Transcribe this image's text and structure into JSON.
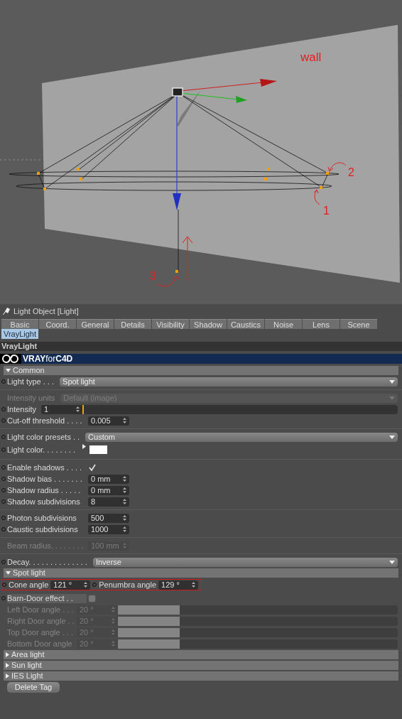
{
  "viewport": {
    "annotations": [
      {
        "text": "wall"
      },
      {
        "text": "2"
      },
      {
        "text": "1"
      },
      {
        "text": "3"
      }
    ]
  },
  "panel": {
    "title": "Light Object [Light]",
    "tabs": [
      {
        "label": "Basic",
        "selected": false
      },
      {
        "label": "Coord.",
        "selected": false
      },
      {
        "label": "General",
        "selected": false
      },
      {
        "label": "Details",
        "selected": false
      },
      {
        "label": "Visibility",
        "selected": false
      },
      {
        "label": "Shadow",
        "selected": false
      },
      {
        "label": "Caustics",
        "selected": false
      },
      {
        "label": "Noise",
        "selected": false
      },
      {
        "label": "Lens",
        "selected": false
      },
      {
        "label": "Scene",
        "selected": false
      },
      {
        "label": "VrayLight",
        "selected": true
      }
    ],
    "section_title": "VrayLight",
    "logo": "**VRAY**for**C4D**",
    "rows": [
      {
        "kind": "group",
        "label": "Common",
        "expanded": true
      },
      {
        "kind": "dropdown",
        "label": "Light type . . .",
        "value": "Spot light",
        "disabled": false
      },
      {
        "kind": "separator"
      },
      {
        "kind": "dropdown",
        "label": "Intensity units",
        "value": "Default (image)",
        "disabled": true
      },
      {
        "kind": "slider",
        "label": "Intensity",
        "value": "1",
        "level": 0,
        "disabled": false
      },
      {
        "kind": "number",
        "label": "Cut-off threshold . . . .",
        "value": "0.005",
        "disabled": false
      },
      {
        "kind": "separator"
      },
      {
        "kind": "dropdown",
        "label": "Light color presets . .",
        "value": "Custom",
        "disabled": false
      },
      {
        "kind": "color",
        "label": "Light color. . . . . . . .",
        "color": "#ffffff",
        "disabled": false
      },
      {
        "kind": "separator"
      },
      {
        "kind": "checkbox",
        "label": "Enable shadows . . . .",
        "checked": true,
        "disabled": false
      },
      {
        "kind": "number",
        "label": "Shadow bias . . . . . . .",
        "value": "0 mm",
        "disabled": false
      },
      {
        "kind": "number",
        "label": "Shadow radius . . . . .",
        "value": "0 mm",
        "disabled": false
      },
      {
        "kind": "number",
        "label": "Shadow subdivisions",
        "value": "8",
        "disabled": false
      },
      {
        "kind": "separator"
      },
      {
        "kind": "number",
        "label": "Photon subdivisions",
        "value": "500",
        "disabled": false
      },
      {
        "kind": "number",
        "label": "Caustic subdivisions",
        "value": "1000",
        "disabled": false
      },
      {
        "kind": "separator"
      },
      {
        "kind": "number",
        "label": "Beam radius. . . . . . . .",
        "value": "100 mm",
        "disabled": true
      },
      {
        "kind": "separator"
      },
      {
        "kind": "dropdown",
        "label": "Decay. . . . . . . . . . . . . .",
        "value": "Inverse",
        "disabled": false
      },
      {
        "kind": "group",
        "label": "Spot light",
        "expanded": true
      },
      {
        "kind": "pair",
        "outlined": true,
        "fields": [
          {
            "label": "Cone angle",
            "value": "121 °"
          },
          {
            "label": "Penumbra angle",
            "value": "129 °"
          }
        ]
      },
      {
        "kind": "checkbox",
        "label": "Barn-Door effect . .",
        "checked": false,
        "disabled": false
      },
      {
        "kind": "slider",
        "label": "Left Door angle . . .",
        "value": "20 °",
        "level": 0.22,
        "disabled": true
      },
      {
        "kind": "slider",
        "label": "Right Door angle . .",
        "value": "20 °",
        "level": 0.22,
        "disabled": true
      },
      {
        "kind": "slider",
        "label": "Top Door angle . . .",
        "value": "20 °",
        "level": 0.22,
        "disabled": true
      },
      {
        "kind": "slider",
        "label": "Bottom Door angle",
        "value": "20 °",
        "level": 0.22,
        "disabled": true
      },
      {
        "kind": "group",
        "label": "Area light",
        "expanded": false
      },
      {
        "kind": "group",
        "label": "Sun light",
        "expanded": false
      },
      {
        "kind": "group",
        "label": "IES Light",
        "expanded": false
      }
    ],
    "button": "Delete Tag"
  }
}
